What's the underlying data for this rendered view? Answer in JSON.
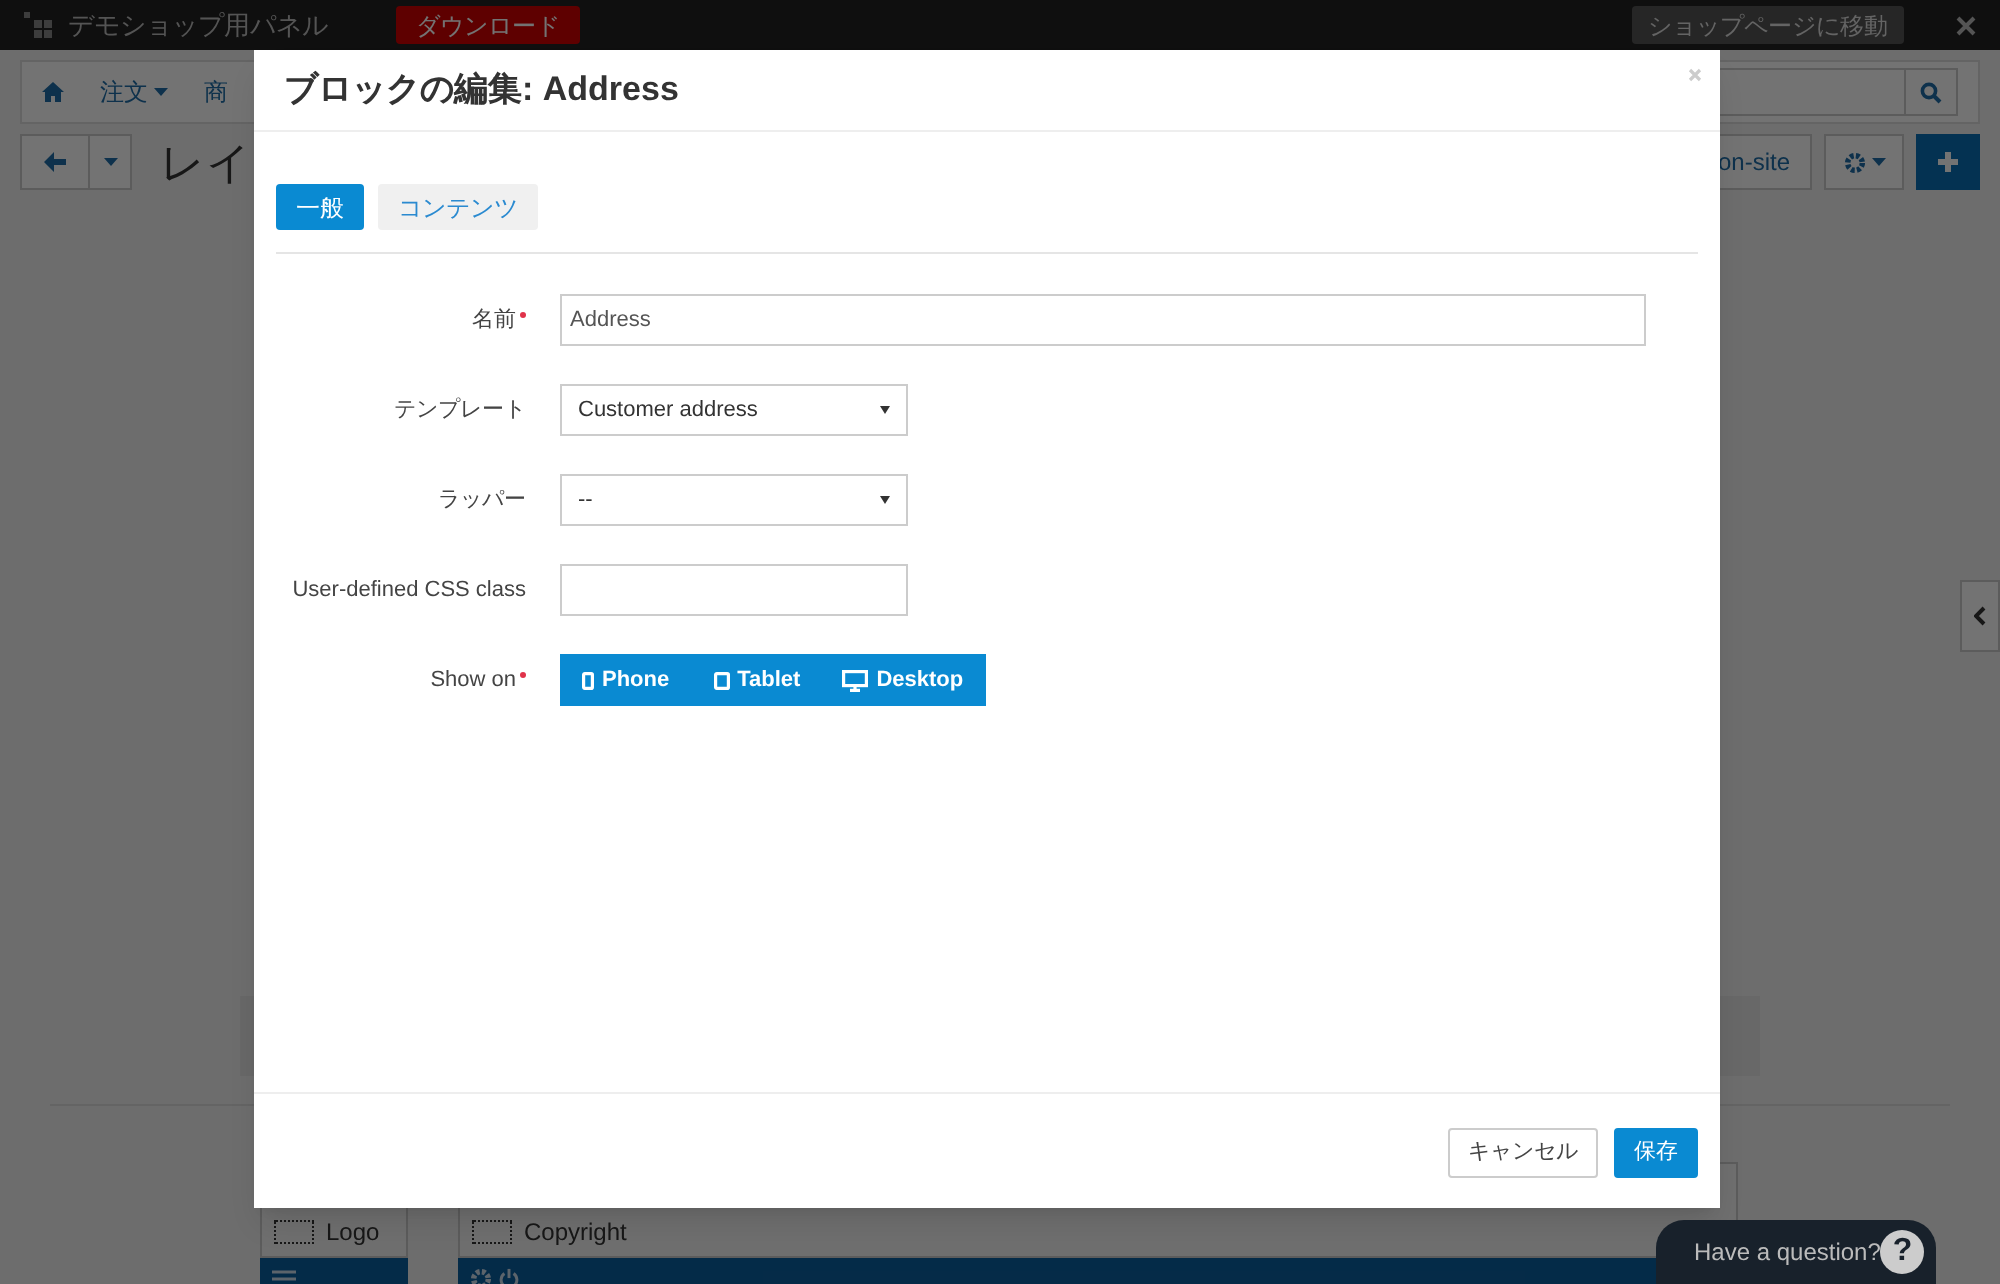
{
  "top_bar": {
    "title": "デモショップ用パネル",
    "download_button": "ダウンロード",
    "shop_link": "ショップページに移動"
  },
  "nav": {
    "items": [
      {
        "label": "注文"
      },
      {
        "label": "商"
      }
    ]
  },
  "toolbar": {
    "page_title": "レイ",
    "onsite_button": "on-site"
  },
  "layout_blocks": [
    {
      "label": "Logo"
    },
    {
      "label": "Copyright"
    }
  ],
  "modal": {
    "title": "ブロックの編集: Address",
    "tabs": [
      {
        "label": "一般",
        "selected": true
      },
      {
        "label": "コンテンツ",
        "selected": false
      }
    ],
    "fields": [
      {
        "kind": "text",
        "label": "名前",
        "required": true,
        "value": "Address"
      },
      {
        "kind": "select",
        "label": "テンプレート",
        "required": false,
        "value": "Customer address"
      },
      {
        "kind": "select",
        "label": "ラッパー",
        "required": false,
        "value": "--"
      },
      {
        "kind": "short-text",
        "label": "User-defined CSS class",
        "required": false
      },
      {
        "kind": "devices",
        "label": "Show on",
        "required": true,
        "options": [
          {
            "label": "Phone",
            "selected": true
          },
          {
            "label": "Tablet",
            "selected": true
          },
          {
            "label": "Desktop",
            "selected": true
          }
        ]
      }
    ],
    "buttons": [
      {
        "label": "キャンセル",
        "kind": "secondary"
      },
      {
        "label": "保存",
        "kind": "primary"
      }
    ]
  },
  "help_widget": {
    "label": "Have a question?",
    "glyph": "?"
  }
}
